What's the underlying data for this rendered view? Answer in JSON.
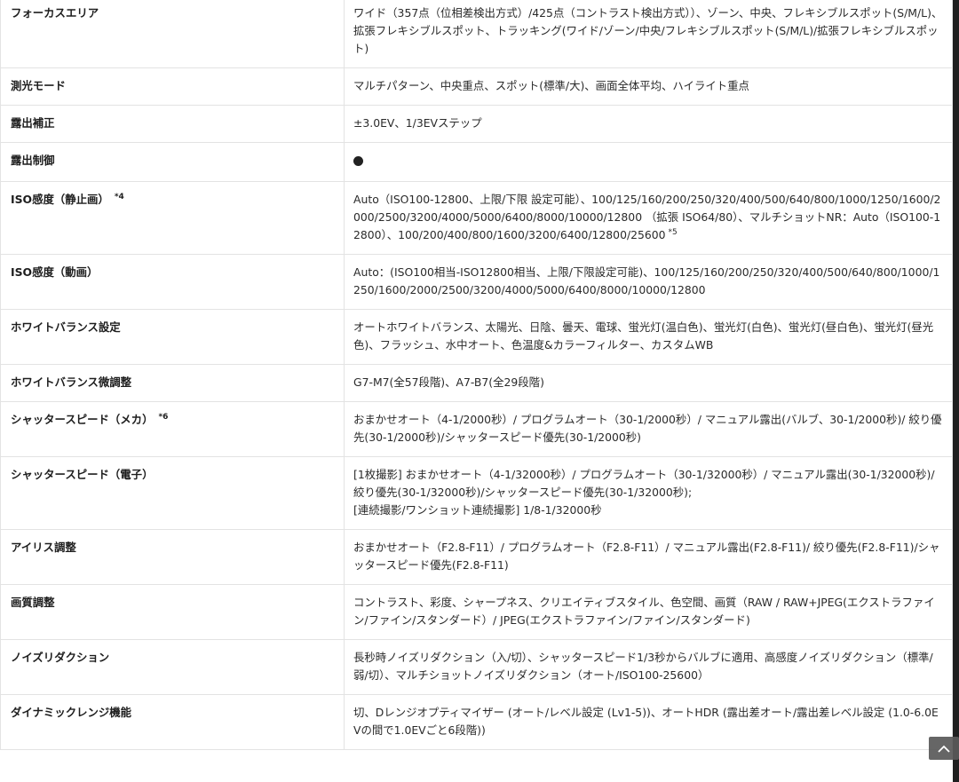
{
  "rows": [
    {
      "label": "フォーカスエリア",
      "value": "ワイド（357点（位相差検出方式）/425点（コントラスト検出方式））、ゾーン、中央、フレキシブルスポット(S/M/L)、拡張フレキシブルスポット、トラッキング(ワイド/ゾーン/中央/フレキシブルスポット(S/M/L)/拡張フレキシブルスポット)"
    },
    {
      "label": "測光モード",
      "value": "マルチパターン、中央重点、スポット(標準/大)、画面全体平均、ハイライト重点"
    },
    {
      "label": "露出補正",
      "value": "±3.0EV、1/3EVステップ"
    },
    {
      "label": "露出制御",
      "value": "●"
    },
    {
      "label": "ISO感度（静止画）",
      "label_note": "*4",
      "value": "Auto（ISO100-12800、上限/下限 設定可能）、100/125/160/200/250/320/400/500/640/800/1000/1250/1600/2000/2500/3200/4000/5000/6400/8000/10000/12800 （拡張 ISO64/80）、マルチショットNR：Auto（ISO100-12800）、100/200/400/800/1600/3200/6400/12800/25600",
      "value_note": "*5"
    },
    {
      "label": "ISO感度（動画）",
      "value": "Auto：(ISO100相当-ISO12800相当、上限/下限設定可能)、100/125/160/200/250/320/400/500/640/800/1000/1250/1600/2000/2500/3200/4000/5000/6400/8000/10000/12800"
    },
    {
      "label": "ホワイトバランス設定",
      "value": "オートホワイトバランス、太陽光、日陰、曇天、電球、蛍光灯(温白色)、蛍光灯(白色)、蛍光灯(昼白色)、蛍光灯(昼光色)、フラッシュ、水中オート、色温度&カラーフィルター、カスタムWB"
    },
    {
      "label": "ホワイトバランス微調整",
      "value": "G7-M7(全57段階)、A7-B7(全29段階)"
    },
    {
      "label": "シャッタースピード（メカ）",
      "label_note": "*6",
      "value": "おまかせオート（4-1/2000秒）/ プログラムオート（30-1/2000秒）/ マニュアル露出(バルブ、30-1/2000秒)/ 絞り優先(30-1/2000秒)/シャッタースピード優先(30-1/2000秒)"
    },
    {
      "label": "シャッタースピード（電子）",
      "value": "[1枚撮影] おまかせオート（4-1/32000秒）/ プログラムオート（30-1/32000秒）/ マニュアル露出(30-1/32000秒)/ 絞り優先(30-1/32000秒)/シャッタースピード優先(30-1/32000秒);",
      "value_line2": "[連続撮影/ワンショット連続撮影] 1/8-1/32000秒"
    },
    {
      "label": "アイリス調整",
      "value": "おまかせオート（F2.8-F11）/ プログラムオート（F2.8-F11）/ マニュアル露出(F2.8-F11)/ 絞り優先(F2.8-F11)/シャッタースピード優先(F2.8-F11)"
    },
    {
      "label": "画質調整",
      "value": "コントラスト、彩度、シャープネス、クリエイティブスタイル、色空間、画質（RAW / RAW+JPEG(エクストラファイン/ファイン/スタンダード）/ JPEG(エクストラファイン/ファイン/スタンダード)"
    },
    {
      "label": "ノイズリダクション",
      "value": "長秒時ノイズリダクション（入/切）、シャッタースピード1/3秒からバルブに適用、高感度ノイズリダクション（標準/弱/切）、マルチショットノイズリダクション（オート/ISO100-25600）"
    },
    {
      "label": "ダイナミックレンジ機能",
      "value": "切、Dレンジオプティマイザー (オート/レベル設定 (Lv1-5))、オートHDR (露出差オート/露出差レベル設定 (1.0-6.0EVの間で1.0EVごと6段階))"
    }
  ],
  "scroll_top_icon": "chevron-up-icon"
}
